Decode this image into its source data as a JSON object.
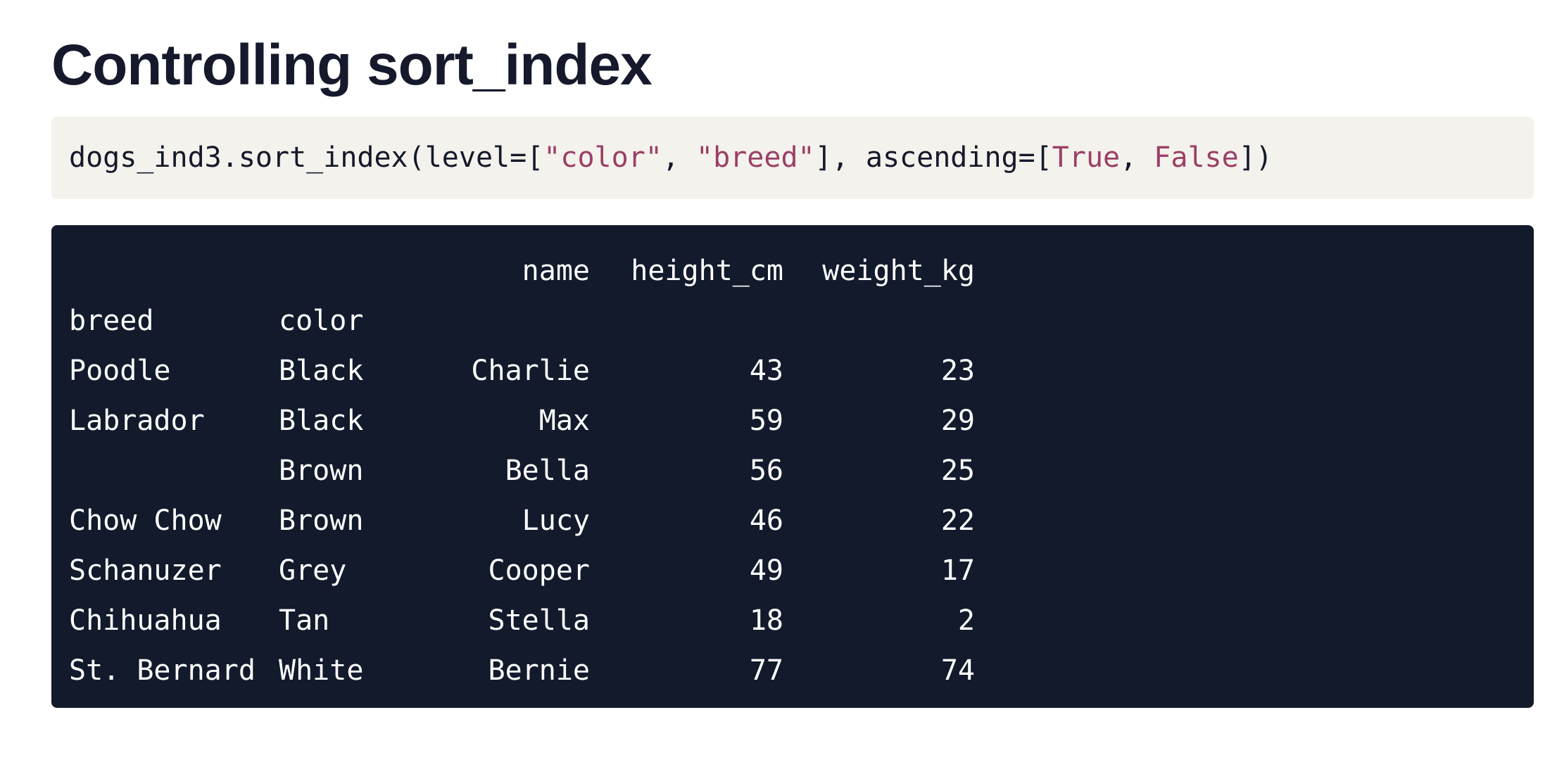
{
  "title": "Controlling sort_index",
  "code": {
    "prefix": "dogs_ind3.sort_index(level=[",
    "arg1": "\"color\"",
    "sep1": ", ",
    "arg2": "\"breed\"",
    "mid": "], ascending=[",
    "bool1": "True",
    "sep2": ", ",
    "bool2": "False",
    "suffix": "])"
  },
  "output": {
    "columns": [
      "name",
      "height_cm",
      "weight_kg"
    ],
    "index_names": [
      "breed",
      "color"
    ],
    "rows": [
      {
        "breed": "Poodle",
        "color": "Black",
        "name": "Charlie",
        "height_cm": "43",
        "weight_kg": "23"
      },
      {
        "breed": "Labrador",
        "color": "Black",
        "name": "Max",
        "height_cm": "59",
        "weight_kg": "29"
      },
      {
        "breed": "",
        "color": "Brown",
        "name": "Bella",
        "height_cm": "56",
        "weight_kg": "25"
      },
      {
        "breed": "Chow Chow",
        "color": "Brown",
        "name": "Lucy",
        "height_cm": "46",
        "weight_kg": "22"
      },
      {
        "breed": "Schanuzer",
        "color": "Grey",
        "name": "Cooper",
        "height_cm": "49",
        "weight_kg": "17"
      },
      {
        "breed": "Chihuahua",
        "color": "Tan",
        "name": "Stella",
        "height_cm": "18",
        "weight_kg": "2"
      },
      {
        "breed": "St. Bernard",
        "color": "White",
        "name": "Bernie",
        "height_cm": "77",
        "weight_kg": "74"
      }
    ]
  }
}
